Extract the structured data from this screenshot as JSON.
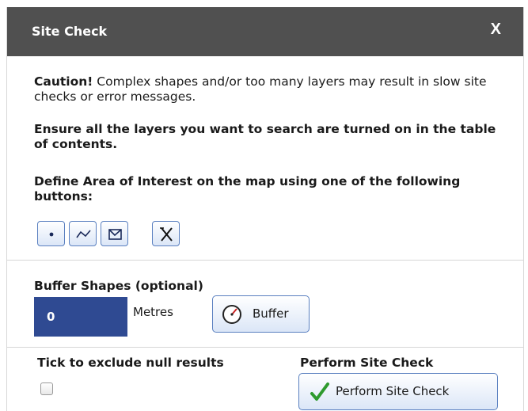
{
  "dialog": {
    "title": "Site Check",
    "close_label": "X"
  },
  "caution": {
    "prefix": "Caution!",
    "message": " Complex shapes and/or too many layers may result in slow site checks or error messages."
  },
  "ensure_text": "Ensure all the layers you want to search are turned on in the table of contents.",
  "define_text": "Define Area of Interest on the map using one of the following buttons:",
  "draw_tools": [
    {
      "name": "point-tool",
      "icon": "point-icon"
    },
    {
      "name": "line-tool",
      "icon": "polyline-icon"
    },
    {
      "name": "polygon-tool",
      "icon": "polygon-icon"
    },
    {
      "name": "clear-tool",
      "icon": "clear-x-icon"
    }
  ],
  "buffer": {
    "label": "Buffer Shapes (optional)",
    "value": "0",
    "unit": "Metres",
    "button_label": "Buffer"
  },
  "exclude": {
    "label": "Tick to exclude null results",
    "checked": false
  },
  "perform": {
    "label": "Perform Site Check",
    "button_label": "Perform Site Check"
  },
  "colors": {
    "titlebar": "#505050",
    "input_bg": "#2f4a92",
    "button_border": "#5a80c0",
    "check_green": "#2e9a2e"
  }
}
